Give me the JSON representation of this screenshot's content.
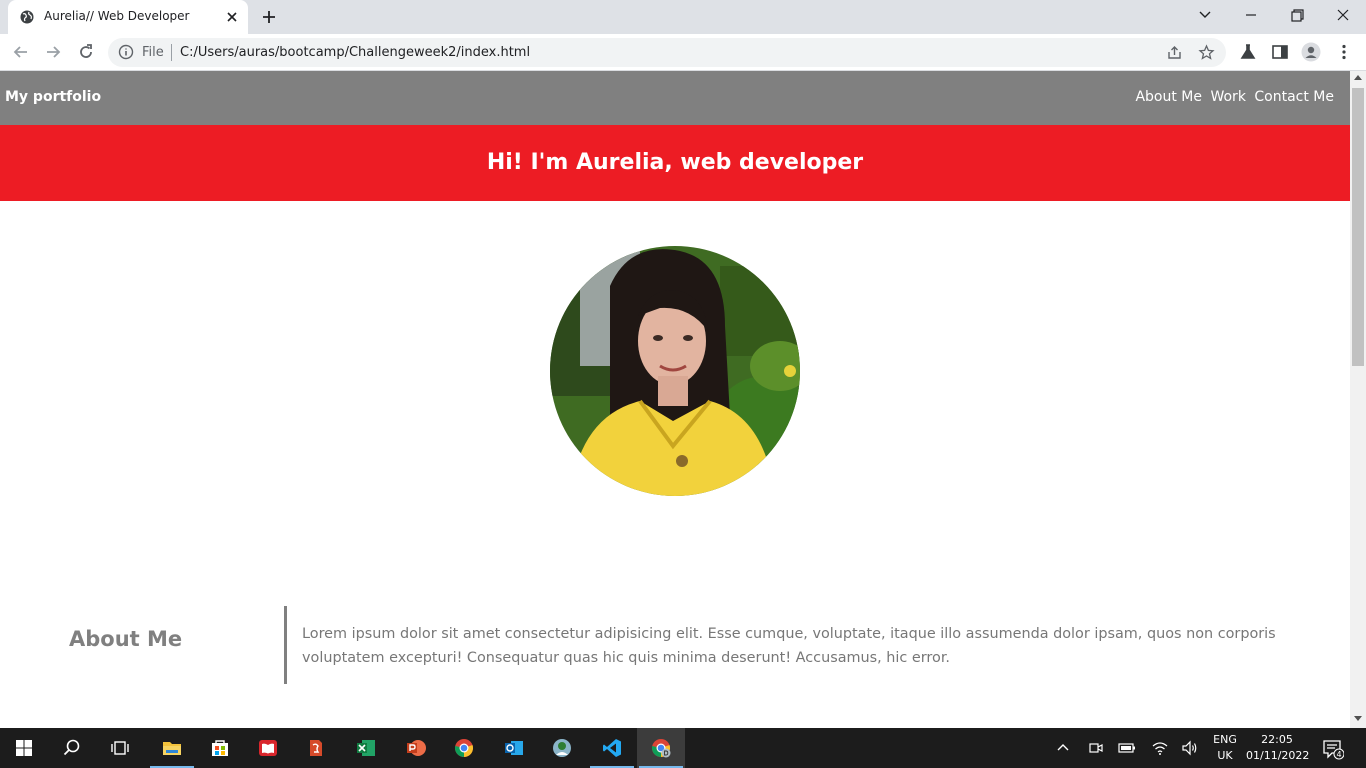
{
  "browser": {
    "tab_title": "Aurelia// Web Developer",
    "url_scheme": "File",
    "url": "C:/Users/auras/bootcamp/Challengeweek2/index.html"
  },
  "page": {
    "brand": "My portfolio",
    "nav": [
      "About Me",
      "Work",
      "Contact Me"
    ],
    "hero_title": "Hi! I'm Aurelia, web developer",
    "about_heading": "About Me",
    "about_text": "Lorem ipsum dolor sit amet consectetur adipisicing elit. Esse cumque, voluptate, itaque illo assumenda dolor ipsam, quos non corporis voluptatem excepturi! Consequatur quas hic quis minima deserunt! Accusamus, hic error.",
    "colors": {
      "navbar": "#808080",
      "hero": "#ed1c24",
      "heading": "#808080"
    }
  },
  "taskbar": {
    "apps": [
      "start-icon",
      "search-icon",
      "task-view-icon",
      "file-explorer-icon",
      "store-icon",
      "reader-icon",
      "app-icon",
      "excel-icon",
      "powerpoint-icon",
      "chrome-icon",
      "outlook-icon",
      "maps-icon",
      "vscode-icon",
      "chrome-dev-icon"
    ],
    "lang": [
      "ENG",
      "UK"
    ],
    "time": "22:05",
    "date": "01/11/2022",
    "notification_count": "4"
  }
}
